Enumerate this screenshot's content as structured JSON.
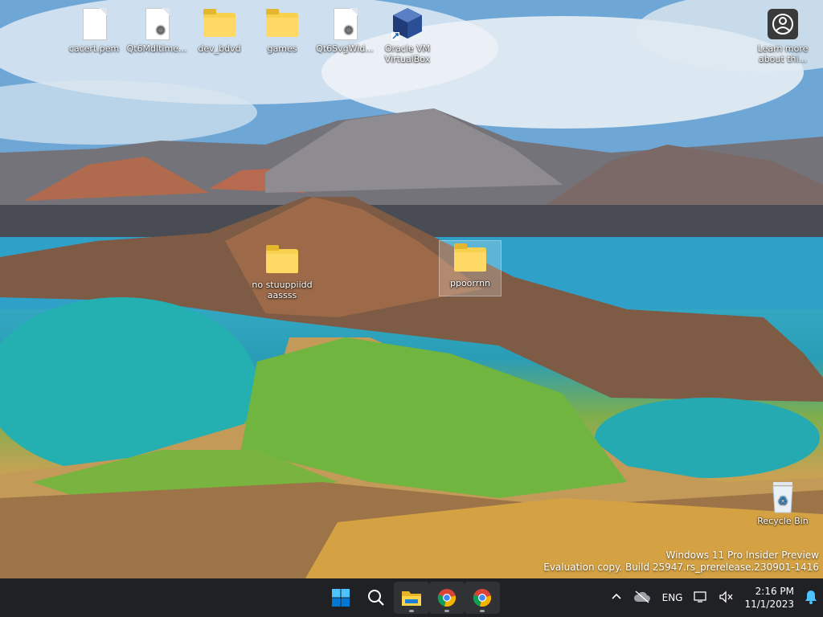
{
  "desktop": {
    "icons": [
      {
        "label": "cacert.pem"
      },
      {
        "label": "Qt6Mdltime..."
      },
      {
        "label": "dev_bdvd"
      },
      {
        "label": "games"
      },
      {
        "label": "Qt6SvgWid..."
      },
      {
        "label": "Oracle VM VirtualBox"
      },
      {
        "label": "Learn more about thi..."
      },
      {
        "label": "no stuuppiidd aassss"
      },
      {
        "label": "ppoorrnn"
      },
      {
        "label": "Recycle Bin"
      }
    ],
    "watermark": {
      "line1": "Windows 11 Pro Insider Preview",
      "line2": "Evaluation copy. Build 25947.rs_prerelease.230901-1416"
    }
  },
  "taskbar": {
    "apps": [
      {
        "icon": "windows-start-icon"
      },
      {
        "icon": "search-icon"
      },
      {
        "icon": "file-explorer-icon"
      },
      {
        "icon": "chrome-icon"
      },
      {
        "icon": "chrome-icon"
      }
    ],
    "tray": {
      "language": "ENG",
      "time": "2:16 PM",
      "date": "11/1/2023"
    }
  },
  "colors": {
    "taskbar_bg": "#202124",
    "folder": "#ffd966",
    "accent": "#0078d4"
  }
}
